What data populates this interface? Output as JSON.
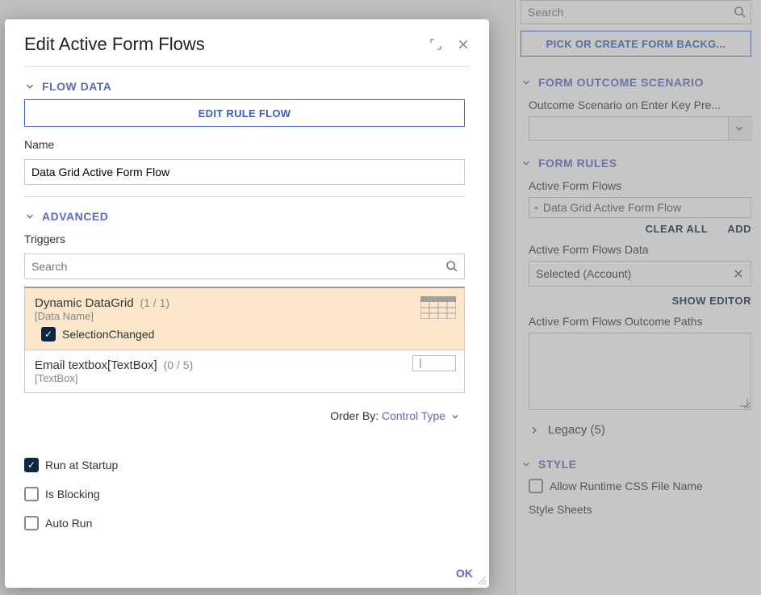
{
  "sidepanel": {
    "search_placeholder": "Search",
    "form_bg_btn": "PICK OR CREATE FORM BACKG...",
    "sections": {
      "outcome": {
        "title": "FORM OUTCOME SCENARIO",
        "enter_key_label": "Outcome Scenario on Enter Key Pre..."
      },
      "rules": {
        "title": "FORM RULES",
        "active_flows_label": "Active Form Flows",
        "active_flows_value": "Data Grid Active Form Flow",
        "clear_all": "CLEAR ALL",
        "add": "ADD",
        "flows_data_label": "Active Form Flows Data",
        "flows_data_value": "Selected (Account)",
        "show_editor": "SHOW EDITOR",
        "outcome_paths_label": "Active Form Flows Outcome Paths",
        "legacy_label": "Legacy (5)"
      },
      "style": {
        "title": "STYLE",
        "allow_runtime_label": "Allow Runtime CSS File Name",
        "style_sheets_label": "Style Sheets"
      }
    }
  },
  "modal": {
    "title": "Edit Active Form Flows",
    "flow_data": {
      "header": "FLOW DATA",
      "edit_rule_btn": "EDIT RULE FLOW",
      "name_label": "Name",
      "name_value": "Data Grid Active Form Flow"
    },
    "advanced": {
      "header": "ADVANCED",
      "triggers_label": "Triggers",
      "search_placeholder": "Search",
      "items": [
        {
          "title": "Dynamic DataGrid",
          "count": "(1 / 1)",
          "sub": "[Data Name]",
          "event": "SelectionChanged",
          "event_checked": true,
          "selected": true,
          "icon": "grid"
        },
        {
          "title": "Email textbox[TextBox]",
          "count": "(0 / 5)",
          "sub": "[TextBox]",
          "selected": false,
          "icon": "textbox"
        }
      ],
      "order_by_label": "Order By:",
      "order_by_value": "Control Type",
      "checks": [
        {
          "label": "Run at Startup",
          "checked": true
        },
        {
          "label": "Is Blocking",
          "checked": false
        },
        {
          "label": "Auto Run",
          "checked": false
        }
      ]
    },
    "ok": "OK"
  }
}
